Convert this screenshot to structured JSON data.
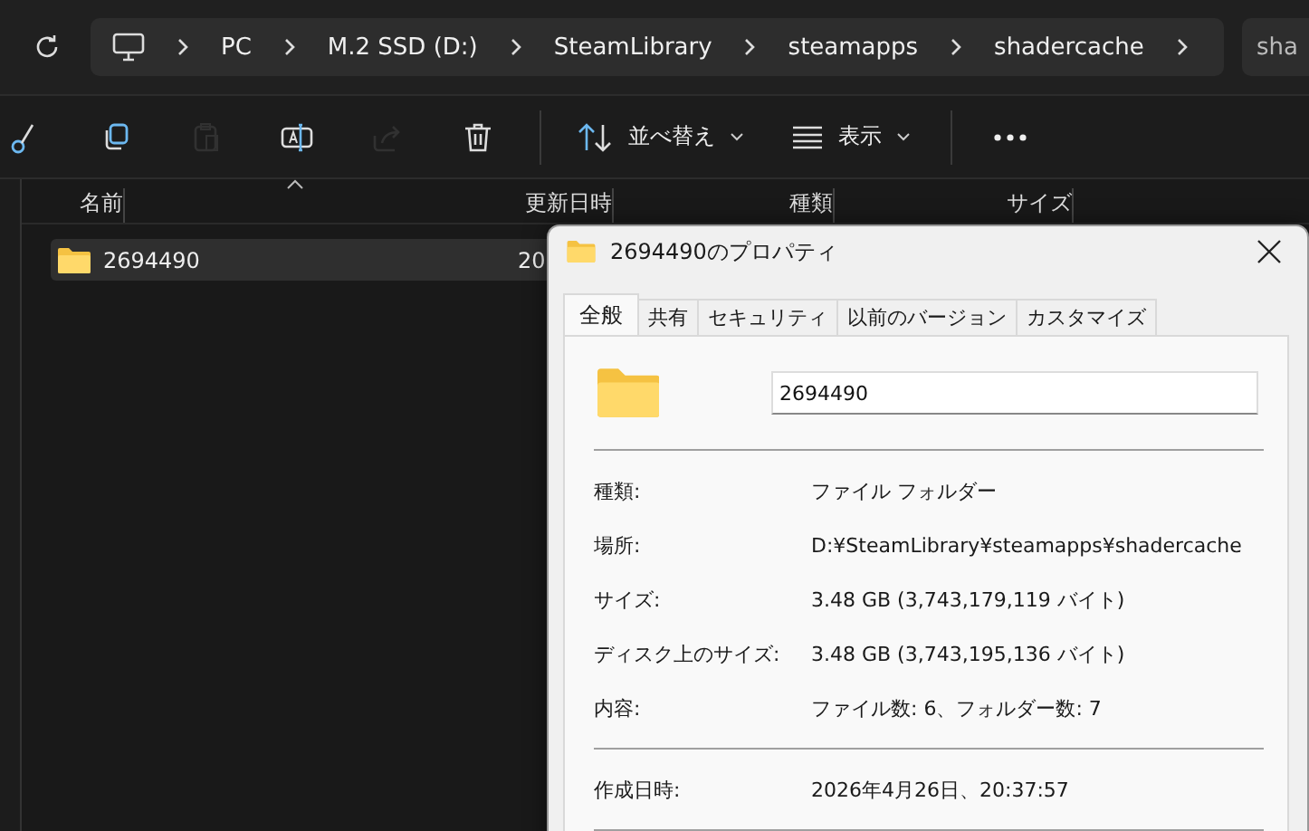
{
  "breadcrumb": [
    "PC",
    "M.2 SSD (D:)",
    "SteamLibrary",
    "steamapps",
    "shadercache"
  ],
  "search": {
    "value": "sha"
  },
  "toolbar": [
    {
      "kind": "cut",
      "disabled": false
    },
    {
      "kind": "copy",
      "disabled": false
    },
    {
      "kind": "paste",
      "disabled": true
    },
    {
      "kind": "rename",
      "disabled": false
    },
    {
      "kind": "share",
      "disabled": true
    },
    {
      "kind": "delete",
      "disabled": false
    }
  ],
  "sort_button": {
    "label": "並べ替え"
  },
  "view_button": {
    "label": "表示"
  },
  "columns": [
    "名前",
    "更新日時",
    "種類",
    "サイズ"
  ],
  "rows": [
    {
      "name": "2694490",
      "date": "20",
      "selected": true
    }
  ],
  "dialog": {
    "title": "2694490のプロパティ",
    "tabs": [
      {
        "label": "全般",
        "selected": true
      },
      {
        "label": "共有",
        "selected": false
      },
      {
        "label": "セキュリティ",
        "selected": false
      },
      {
        "label": "以前のバージョン",
        "selected": false
      },
      {
        "label": "カスタマイズ",
        "selected": false
      }
    ],
    "name_value": "2694490",
    "groups": [
      [
        {
          "label": "種類:",
          "value": "ファイル フォルダー"
        },
        {
          "label": "場所:",
          "value": "D:¥SteamLibrary¥steamapps¥shadercache"
        },
        {
          "label": "サイズ:",
          "value": "3.48 GB (3,743,179,119 バイト)"
        },
        {
          "label": "ディスク上のサイズ:",
          "value": "3.48 GB (3,743,195,136 バイト)"
        },
        {
          "label": "内容:",
          "value": "ファイル数: 6、フォルダー数: 7"
        }
      ],
      [
        {
          "label": "作成日時:",
          "value": "2026年4月26日、20:37:57"
        }
      ]
    ]
  }
}
